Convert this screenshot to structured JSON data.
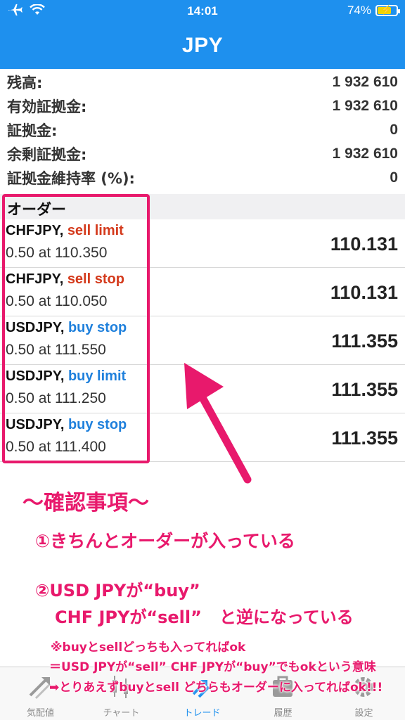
{
  "status_bar": {
    "time": "14:01",
    "battery": "74%",
    "battery_fraction": 0.74
  },
  "header": {
    "title": "JPY"
  },
  "balance": [
    {
      "label": "残高:",
      "value": "1 932 610"
    },
    {
      "label": "有効証拠金:",
      "value": "1 932 610"
    },
    {
      "label": "証拠金:",
      "value": "0"
    },
    {
      "label": "余剰証拠金:",
      "value": "1 932 610"
    },
    {
      "label": "証拠金維持率 (%):",
      "value": "0"
    }
  ],
  "orders_section": {
    "title": "オーダー"
  },
  "orders": [
    {
      "symbol": "CHFJPY,",
      "type": "sell limit",
      "side": "sell",
      "detail": "0.50 at 110.350",
      "price": "110.131"
    },
    {
      "symbol": "CHFJPY,",
      "type": "sell stop",
      "side": "sell",
      "detail": "0.50 at 110.050",
      "price": "110.131"
    },
    {
      "symbol": "USDJPY,",
      "type": "buy stop",
      "side": "buy",
      "detail": "0.50 at 111.550",
      "price": "111.355"
    },
    {
      "symbol": "USDJPY,",
      "type": "buy limit",
      "side": "buy",
      "detail": "0.50 at 111.250",
      "price": "111.355"
    },
    {
      "symbol": "USDJPY,",
      "type": "buy stop",
      "side": "buy",
      "detail": "0.50 at 111.400",
      "price": "111.355"
    }
  ],
  "annotations": {
    "heading": "〜確認事項〜",
    "item1": "①きちんとオーダーが入っている",
    "item2a": "②USD JPYが“buy”",
    "item2b": "CHF JPYが“sell”",
    "item2c": "と逆になっている",
    "small1": "※buyとsellどっちも入ってればok",
    "small2": "＝USD JPYが“sell” CHF JPYが“buy”でもokという意味",
    "small3": "➡とりあえずbuyとsell どちらもオーダーに入ってればok!!!"
  },
  "tabs": [
    {
      "label": "気配値",
      "icon": "quotes-icon",
      "active": false
    },
    {
      "label": "チャート",
      "icon": "chart-icon",
      "active": false
    },
    {
      "label": "トレード",
      "icon": "trade-icon",
      "active": true
    },
    {
      "label": "履歴",
      "icon": "history-icon",
      "active": false
    },
    {
      "label": "設定",
      "icon": "settings-icon",
      "active": false
    }
  ],
  "colors": {
    "header": "#1e90ee",
    "sell": "#d43a1c",
    "buy": "#1f80dc",
    "annotation": "#e8196c",
    "tab_active": "#1e90ee",
    "tab_inactive": "#8a8a8a"
  }
}
